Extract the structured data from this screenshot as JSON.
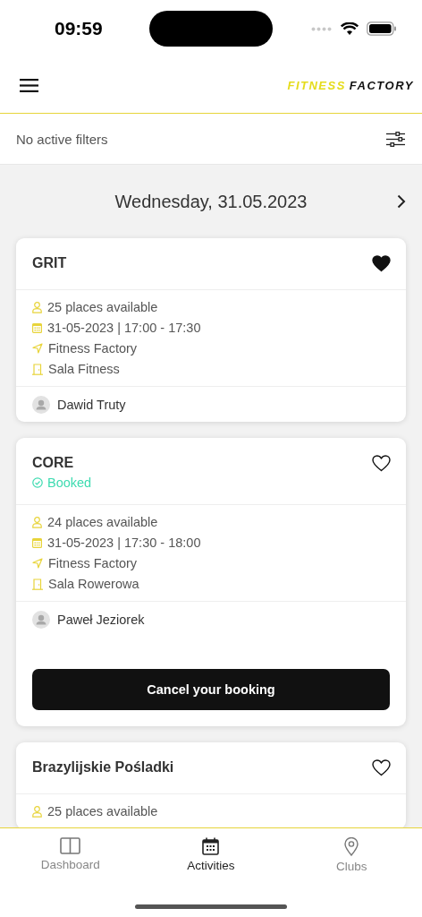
{
  "status_bar": {
    "time": "09:59"
  },
  "header": {
    "logo": {
      "part_1": "FITNESS",
      "part_2": "FACTORY"
    }
  },
  "filters": {
    "label": "No active filters"
  },
  "date_nav": {
    "date": "Wednesday, 31.05.2023"
  },
  "activities": [
    {
      "title": "GRIT",
      "favorite": true,
      "booked": false,
      "places": "25 places available",
      "datetime": "31-05-2023 | 17:00 - 17:30",
      "club": "Fitness Factory",
      "room": "Sala Fitness",
      "trainer": "Dawid Truty"
    },
    {
      "title": "CORE",
      "favorite": false,
      "booked": true,
      "status": "Booked",
      "places": "24 places available",
      "datetime": "31-05-2023 | 17:30 - 18:00",
      "club": "Fitness Factory",
      "room": "Sala Rowerowa",
      "trainer": "Paweł Jeziorek",
      "action": "Cancel your booking"
    },
    {
      "title": "Brazylijskie Pośladki",
      "favorite": false,
      "booked": false,
      "places": "25 places available"
    }
  ],
  "tab_bar": [
    {
      "label": "Dashboard",
      "kind": "dashboard",
      "selected": false
    },
    {
      "label": "Activities",
      "kind": "calendar",
      "selected": true
    },
    {
      "label": "Clubs",
      "kind": "pin",
      "selected": false
    }
  ]
}
